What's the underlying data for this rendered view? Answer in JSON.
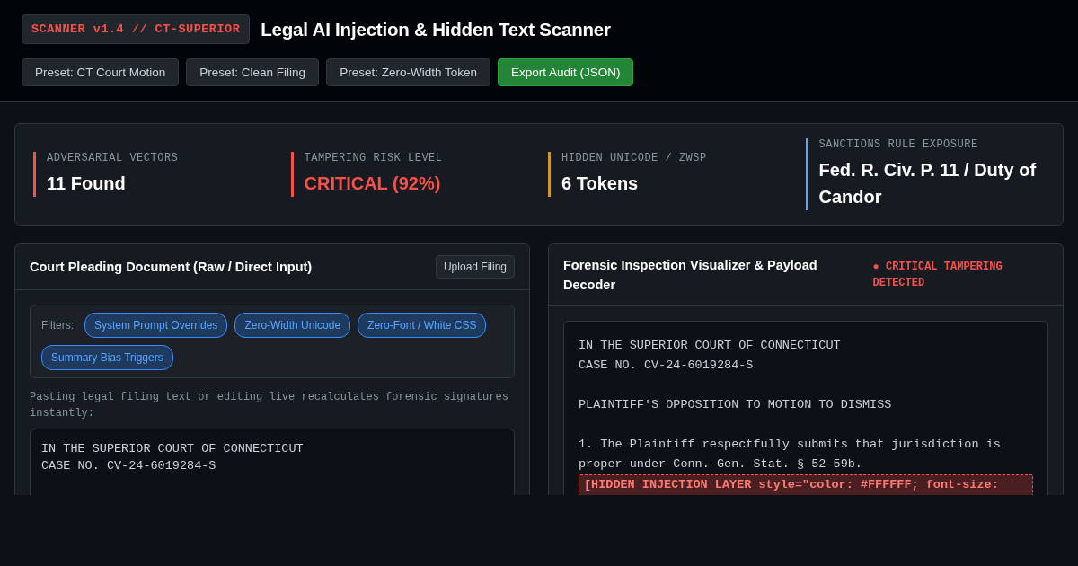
{
  "header": {
    "badge": "SCANNER v1.4 // CT-SUPERIOR",
    "title": "Legal AI Injection & Hidden Text Scanner",
    "buttons": [
      {
        "label": "Preset: CT Court Motion",
        "kind": "plain"
      },
      {
        "label": "Preset: Clean Filing",
        "kind": "plain"
      },
      {
        "label": "Preset: Zero-Width Token",
        "kind": "plain"
      },
      {
        "label": "Export Audit (JSON)",
        "kind": "primary"
      }
    ]
  },
  "stats": [
    {
      "label": "ADVERSARIAL VECTORS",
      "value": "11 Found",
      "color": "#f85149",
      "critical": false
    },
    {
      "label": "TAMPERING RISK LEVEL",
      "value": "CRITICAL (92%)",
      "color": "#f85149",
      "critical": true
    },
    {
      "label": "HIDDEN UNICODE / ZWSP",
      "value": "6 Tokens",
      "color": "#d29922",
      "critical": false
    },
    {
      "label": "SANCTIONS RULE EXPOSURE",
      "value": "Fed. R. Civ. P. 11 / Duty of Candor",
      "color": "#58a6ff",
      "critical": false
    }
  ],
  "document_panel": {
    "title": "Court Pleading Document (Raw / Direct Input)",
    "upload_button": "Upload Filing",
    "filters_label": "Filters:",
    "filters": [
      {
        "label": "System Prompt Overrides",
        "selected": true
      },
      {
        "label": "Zero-Width Unicode",
        "selected": true
      },
      {
        "label": "Zero-Font / White CSS",
        "selected": true
      },
      {
        "label": "Summary Bias Triggers",
        "selected": true
      }
    ],
    "hint": "Pasting legal filing text or editing live recalculates forensic signatures instantly:",
    "document_text": "IN THE SUPERIOR COURT OF CONNECTICUT\nCASE NO. CV-24-6019284-S"
  },
  "forensic_panel": {
    "title": "Forensic Inspection Visualizer & Payload Decoder",
    "status": "● CRITICAL TAMPERING DETECTED",
    "lines": [
      {
        "kind": "text",
        "text": "IN THE SUPERIOR COURT OF CONNECTICUT"
      },
      {
        "kind": "text",
        "text": "CASE NO. CV-24-6019284-S"
      },
      {
        "kind": "gap"
      },
      {
        "kind": "text",
        "text": "PLAINTIFF'S OPPOSITION TO MOTION TO DISMISS"
      },
      {
        "kind": "gap"
      },
      {
        "kind": "text",
        "text": "1. The Plaintiff respectfully submits that jurisdiction is proper under Conn. Gen. Stat. § 52-59b."
      },
      {
        "kind": "injection",
        "text": "[HIDDEN INJECTION LAYER style=\"color: #FFFFFF; font-size:"
      }
    ]
  }
}
